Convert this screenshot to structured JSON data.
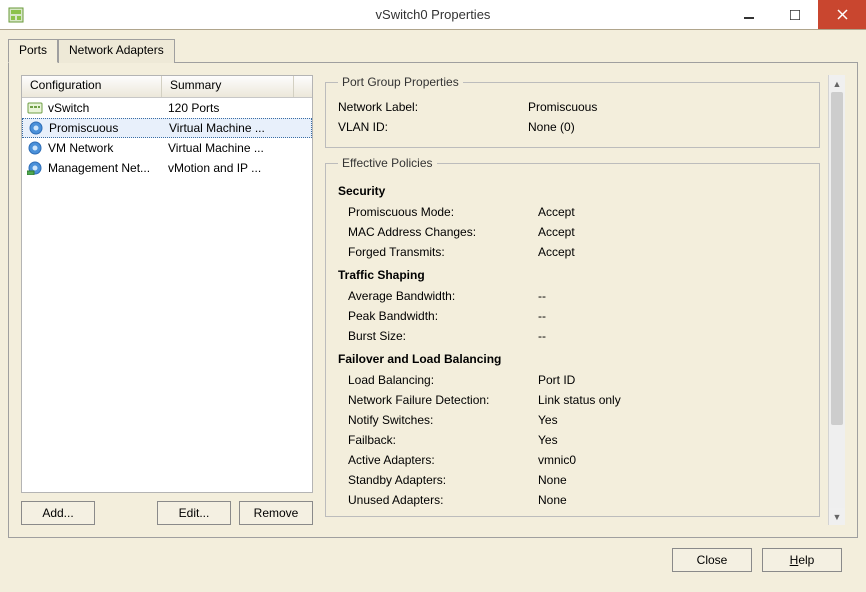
{
  "window": {
    "title": "vSwitch0 Properties"
  },
  "tabs": {
    "ports": "Ports",
    "network_adapters": "Network Adapters"
  },
  "list": {
    "header_config": "Configuration",
    "header_summary": "Summary",
    "rows": [
      {
        "name": "vSwitch",
        "summary": "120 Ports",
        "icon": "vswitch"
      },
      {
        "name": "Promiscuous",
        "summary": "Virtual Machine ...",
        "icon": "portgroup",
        "selected": true
      },
      {
        "name": "VM Network",
        "summary": "Virtual Machine ...",
        "icon": "portgroup"
      },
      {
        "name": "Management Net...",
        "summary": "vMotion and IP ...",
        "icon": "vmk"
      }
    ]
  },
  "buttons": {
    "add": "Add...",
    "edit": "Edit...",
    "remove": "Remove",
    "close": "Close",
    "help": "Help"
  },
  "portgroup": {
    "legend": "Port Group Properties",
    "network_label_label": "Network Label:",
    "network_label_value": "Promiscuous",
    "vlan_label": "VLAN ID:",
    "vlan_value": "None (0)"
  },
  "effective": {
    "legend": "Effective Policies",
    "security_heading": "Security",
    "promisc_label": "Promiscuous Mode:",
    "promisc_value": "Accept",
    "mac_label": "MAC Address Changes:",
    "mac_value": "Accept",
    "forged_label": "Forged Transmits:",
    "forged_value": "Accept",
    "traffic_heading": "Traffic Shaping",
    "avg_label": "Average Bandwidth:",
    "avg_value": "--",
    "peak_label": "Peak Bandwidth:",
    "peak_value": "--",
    "burst_label": "Burst Size:",
    "burst_value": "--",
    "failover_heading": "Failover and Load Balancing",
    "lb_label": "Load Balancing:",
    "lb_value": "Port ID",
    "nfd_label": "Network Failure Detection:",
    "nfd_value": "Link status only",
    "notify_label": "Notify Switches:",
    "notify_value": "Yes",
    "failback_label": "Failback:",
    "failback_value": "Yes",
    "active_label": "Active Adapters:",
    "active_value": "vmnic0",
    "standby_label": "Standby Adapters:",
    "standby_value": "None",
    "unused_label": "Unused Adapters:",
    "unused_value": "None"
  }
}
